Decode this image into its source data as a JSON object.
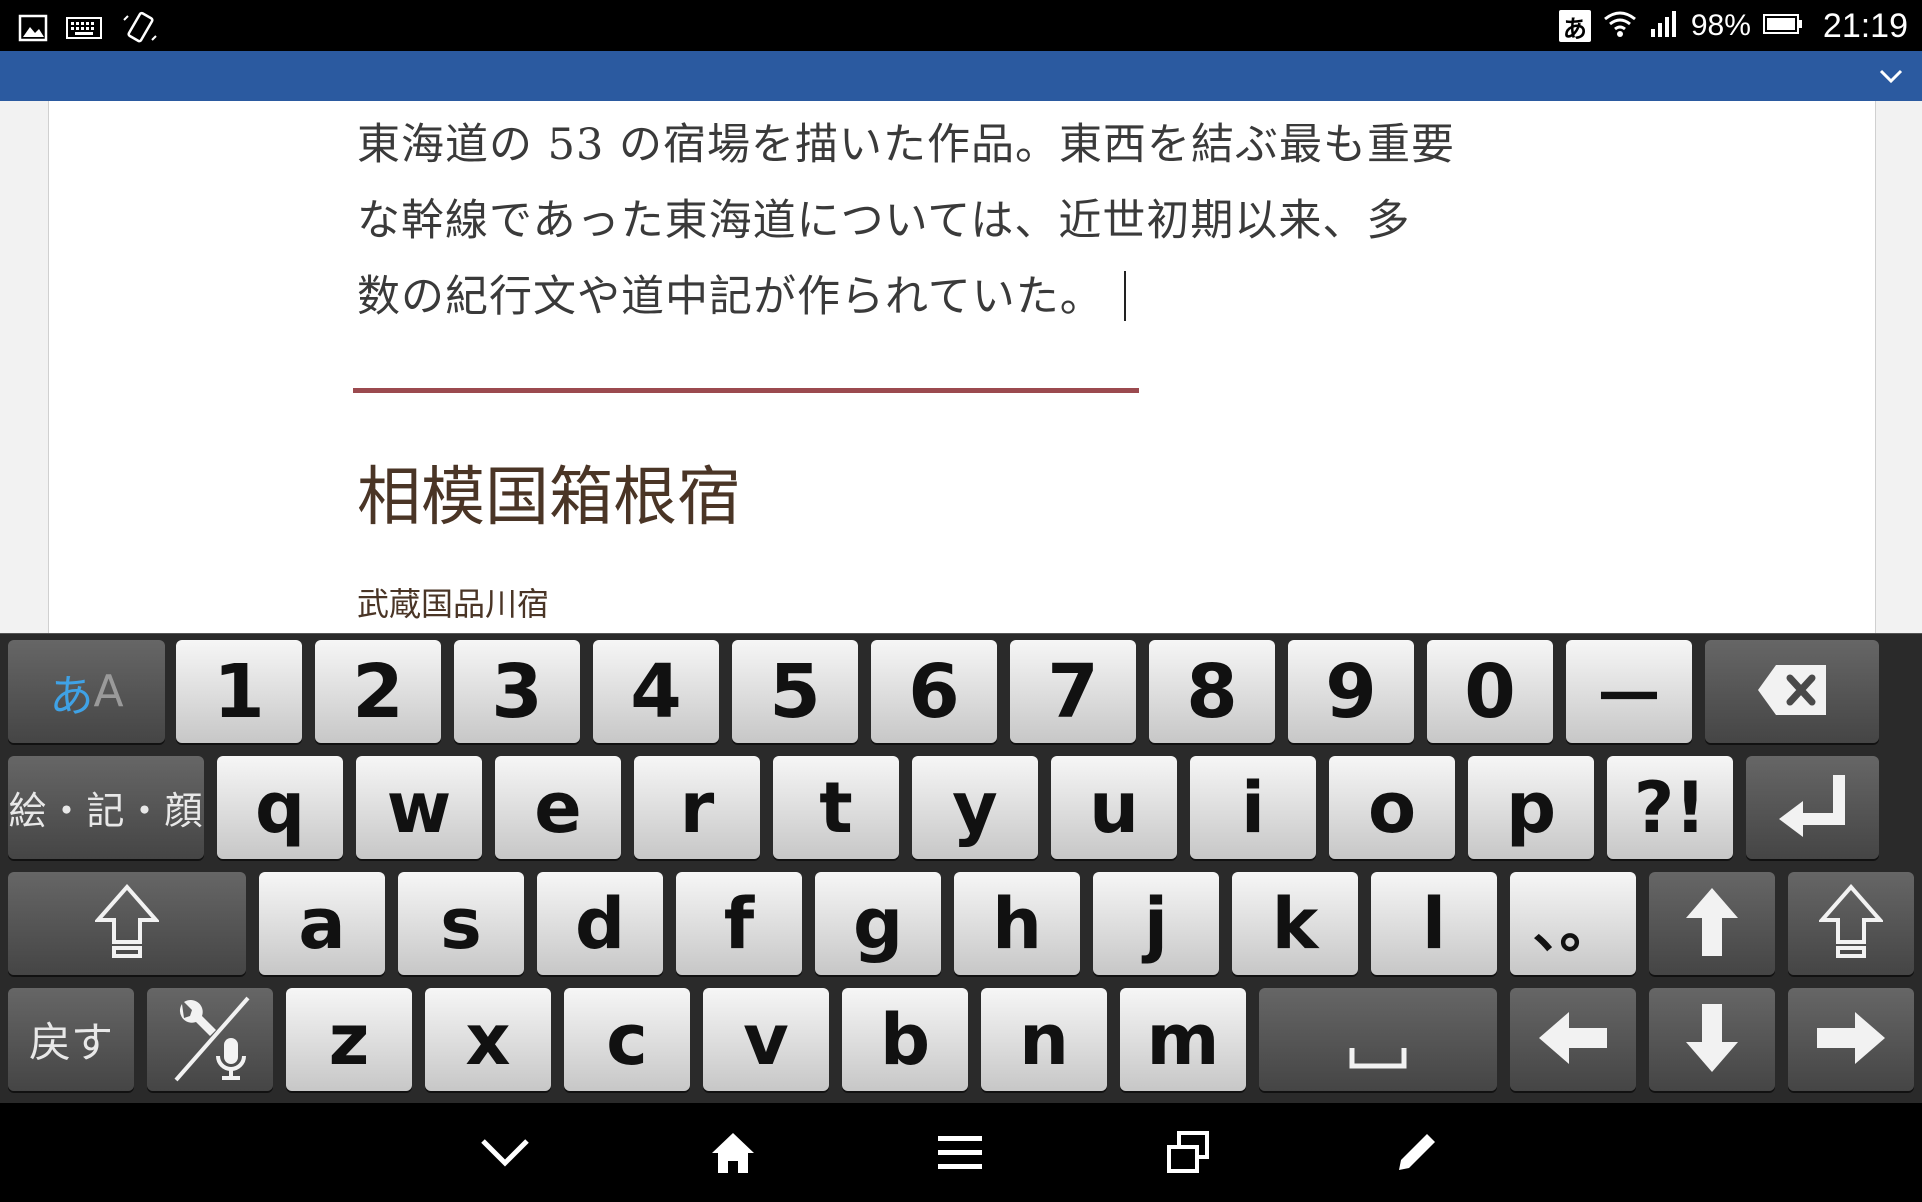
{
  "status_bar": {
    "left_icons": [
      "image-notification-icon",
      "keyboard-notification-icon",
      "rotate-screen-icon"
    ],
    "ime_indicator": "あ",
    "battery_percent": "98%",
    "time": "21:19"
  },
  "app_bar": {
    "color": "#2b5aa0",
    "collapse_icon": "chevron-down-icon"
  },
  "document": {
    "paragraph_lines": [
      "東海道の 53 の宿場を描いた作品。東西を結ぶ最も重要",
      "な幹線であった東海道については、近世初期以来、多",
      "数の紀行文や道中記が作られていた。"
    ],
    "heading": "相模国箱根宿",
    "subheading": "武蔵国品川宿",
    "rule_color": "#9b4a4f"
  },
  "keyboard": {
    "mode_key": {
      "kana": "あ",
      "latin": "A"
    },
    "row1": [
      "1",
      "2",
      "3",
      "4",
      "5",
      "6",
      "7",
      "8",
      "9",
      "0",
      "－"
    ],
    "row2_left": "絵・記・顔",
    "row2": [
      "q",
      "w",
      "e",
      "r",
      "t",
      "y",
      "u",
      "i",
      "o",
      "p",
      "?!"
    ],
    "row3": [
      "a",
      "s",
      "d",
      "f",
      "g",
      "h",
      "j",
      "k",
      "l",
      "、。"
    ],
    "row4_left": "戻す",
    "row4": [
      "z",
      "x",
      "c",
      "v",
      "b",
      "n",
      "m"
    ],
    "icons": {
      "backspace": "backspace-icon",
      "enter": "enter-icon",
      "shift": "shift-icon",
      "settings_voice": "settings-voice-icon",
      "space": "space-icon",
      "arrow_up": "arrow-up-icon",
      "arrow_left": "arrow-left-icon",
      "arrow_down": "arrow-down-icon",
      "arrow_right": "arrow-right-icon"
    }
  },
  "nav_bar": {
    "buttons": [
      "hide-keyboard-icon",
      "home-icon",
      "menu-icon",
      "recent-apps-icon",
      "edit-icon"
    ]
  }
}
